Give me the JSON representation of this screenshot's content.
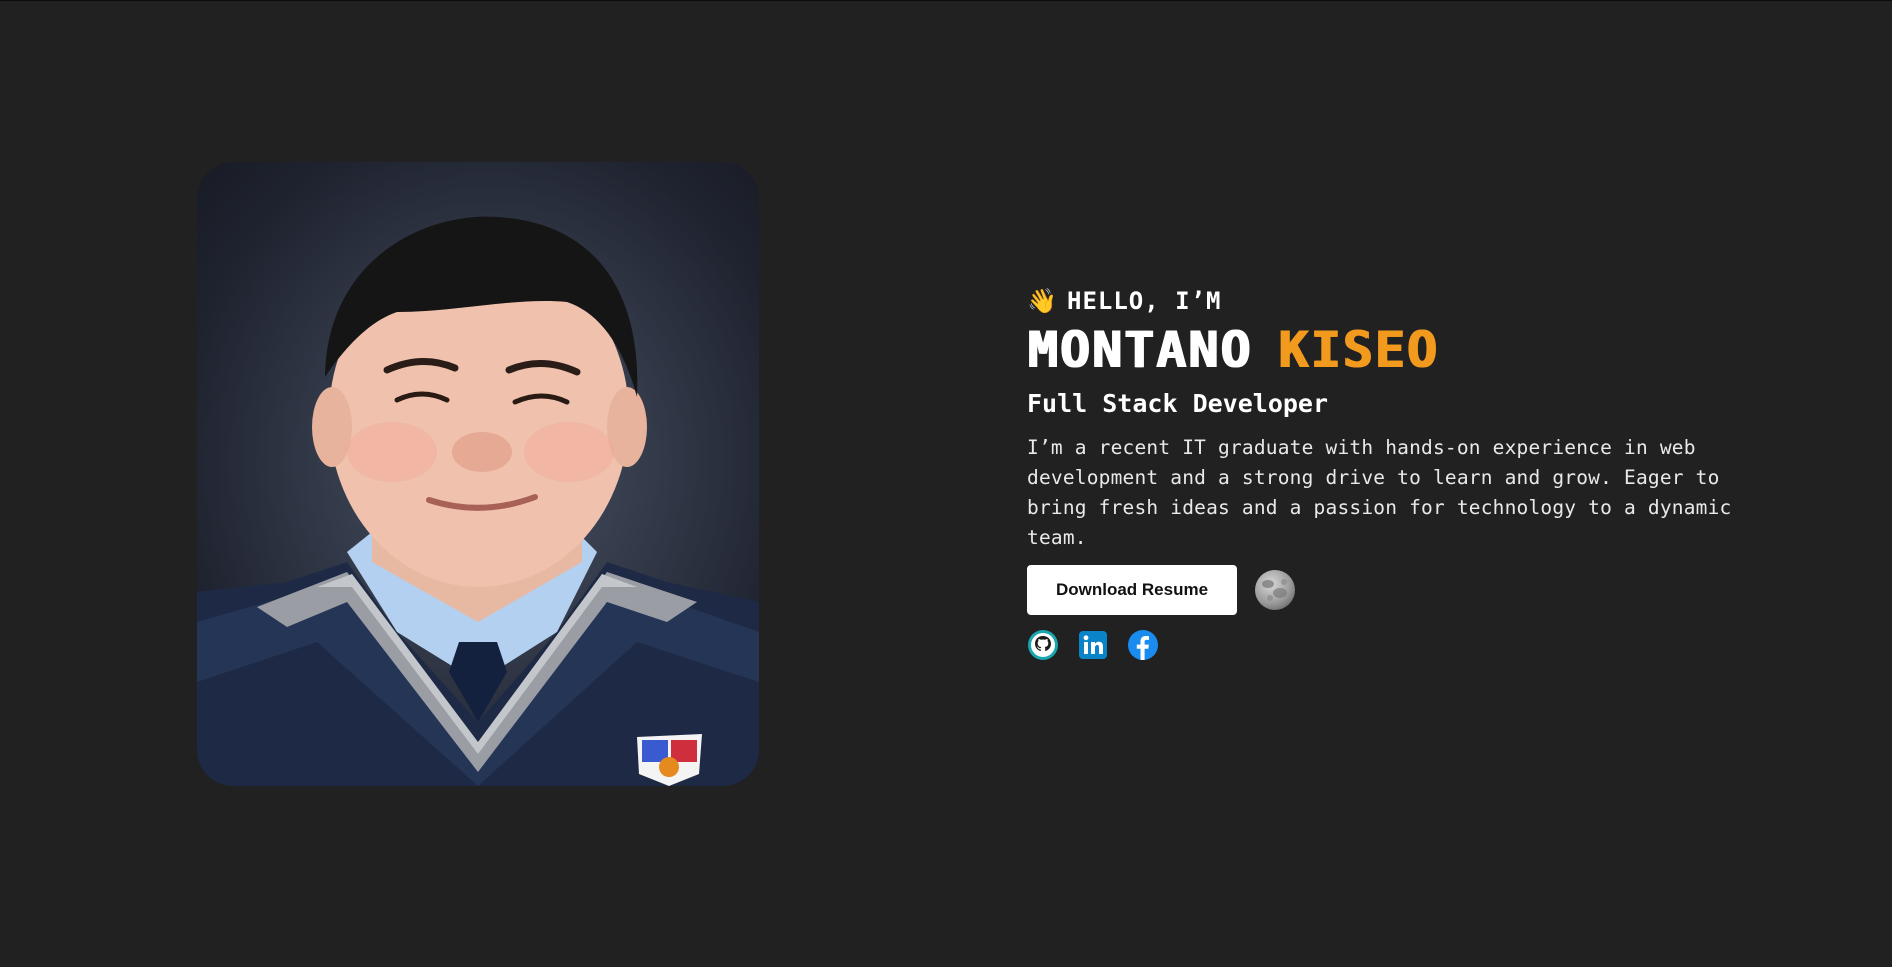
{
  "hero": {
    "greeting_emoji": "👋",
    "greeting": "HELLO, I’M",
    "first_name": "MONTANO",
    "last_name": "KISEO",
    "role": "Full Stack Developer",
    "bio": "I’m a recent IT graduate with hands-on experience in web development and a strong drive to learn and grow. Eager to bring fresh ideas and a passion for technology to a dynamic team.",
    "resume_button": "Download Resume"
  },
  "icons": {
    "theme_toggle": "moon-icon",
    "socials": [
      "github-icon",
      "linkedin-icon",
      "facebook-icon"
    ]
  },
  "colors": {
    "background": "#212121",
    "accent": "#f29a1d",
    "text": "#ffffff",
    "github": "#1aa6b0",
    "linkedin": "#0a84c8",
    "facebook": "#1a8cf0"
  }
}
